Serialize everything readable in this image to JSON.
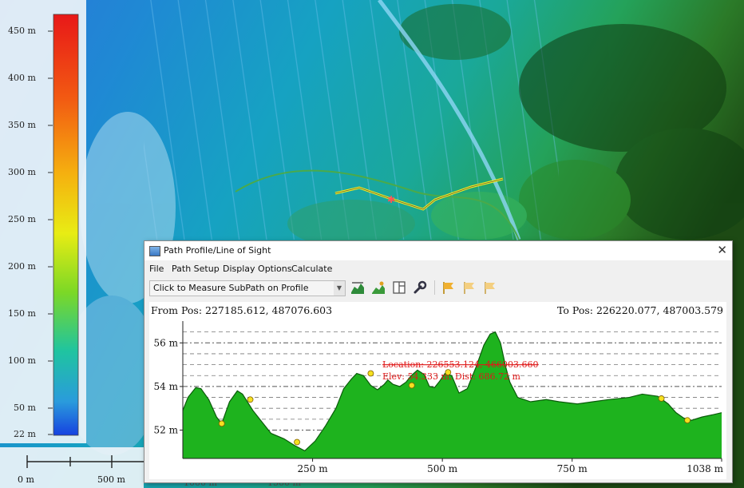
{
  "map": {
    "legend": {
      "ticks": [
        "450 m",
        "400 m",
        "350 m",
        "300 m",
        "250 m",
        "200 m",
        "150 m",
        "100 m",
        "50 m",
        "22 m"
      ]
    },
    "scale_bar": {
      "labels": [
        "0 m",
        "500 m",
        "1000 m",
        "1500 m"
      ]
    }
  },
  "dialog": {
    "title": "Path Profile/Line of Sight",
    "close_label": "✕",
    "menu": [
      "File",
      "Path Setup",
      "Display Options",
      "Calculate"
    ],
    "toolbar": {
      "mode_select_value": "Click to Measure SubPath on Profile",
      "buttons": [
        "profile-view-icon",
        "terrain-icon",
        "panel-icon",
        "wrench-icon",
        "flag-icon",
        "flag-left-icon",
        "flag-right-icon"
      ]
    },
    "profile": {
      "from_pos": "From Pos: 227185.612, 487076.603",
      "to_pos": "To Pos: 226220.077, 487003.579",
      "location_text": "Location: 226553.124, 466003.660",
      "elev_text": "Elev: 54.333 m, Dist: 686.72 m"
    }
  },
  "chart_data": {
    "type": "area",
    "x_tick_labels": [
      "250 m",
      "500 m",
      "750 m",
      "1038 m"
    ],
    "y_tick_labels": [
      "52 m",
      "54 m",
      "56 m"
    ],
    "xlim": [
      0,
      1038
    ],
    "ylim": [
      50.7,
      57.0
    ],
    "grid": true,
    "fill_color": "#1eb31e",
    "line_color": "#0a5a0a",
    "points": [
      [
        0,
        52.9
      ],
      [
        10,
        53.5
      ],
      [
        25,
        53.95
      ],
      [
        35,
        53.9
      ],
      [
        50,
        53.4
      ],
      [
        65,
        52.6
      ],
      [
        75,
        52.3
      ],
      [
        90,
        53.3
      ],
      [
        105,
        53.8
      ],
      [
        115,
        53.65
      ],
      [
        135,
        52.9
      ],
      [
        155,
        52.3
      ],
      [
        170,
        51.85
      ],
      [
        195,
        51.6
      ],
      [
        215,
        51.3
      ],
      [
        235,
        51.05
      ],
      [
        255,
        51.5
      ],
      [
        275,
        52.2
      ],
      [
        295,
        53.0
      ],
      [
        310,
        53.9
      ],
      [
        325,
        54.35
      ],
      [
        335,
        54.6
      ],
      [
        348,
        54.5
      ],
      [
        362,
        54.05
      ],
      [
        375,
        53.85
      ],
      [
        388,
        54.1
      ],
      [
        395,
        54.3
      ],
      [
        405,
        54.1
      ],
      [
        418,
        54.0
      ],
      [
        430,
        54.2
      ],
      [
        440,
        54.5
      ],
      [
        452,
        54.75
      ],
      [
        465,
        54.55
      ],
      [
        475,
        54.0
      ],
      [
        485,
        53.95
      ],
      [
        495,
        54.25
      ],
      [
        505,
        54.6
      ],
      [
        518,
        54.5
      ],
      [
        532,
        53.7
      ],
      [
        548,
        53.9
      ],
      [
        565,
        54.9
      ],
      [
        580,
        55.9
      ],
      [
        592,
        56.4
      ],
      [
        602,
        56.5
      ],
      [
        612,
        56.0
      ],
      [
        622,
        54.9
      ],
      [
        630,
        54.2
      ],
      [
        645,
        53.5
      ],
      [
        670,
        53.3
      ],
      [
        700,
        53.4
      ],
      [
        725,
        53.3
      ],
      [
        760,
        53.2
      ],
      [
        790,
        53.3
      ],
      [
        820,
        53.4
      ],
      [
        860,
        53.5
      ],
      [
        885,
        53.65
      ],
      [
        915,
        53.55
      ],
      [
        935,
        53.2
      ],
      [
        950,
        52.8
      ],
      [
        965,
        52.55
      ],
      [
        980,
        52.45
      ],
      [
        1000,
        52.6
      ],
      [
        1020,
        52.7
      ],
      [
        1038,
        52.8
      ]
    ],
    "markers": [
      [
        75,
        52.3
      ],
      [
        130,
        53.4
      ],
      [
        220,
        51.45
      ],
      [
        362,
        54.6
      ],
      [
        441,
        54.05
      ],
      [
        511,
        54.65
      ],
      [
        922,
        53.45
      ],
      [
        972,
        52.45
      ]
    ]
  }
}
